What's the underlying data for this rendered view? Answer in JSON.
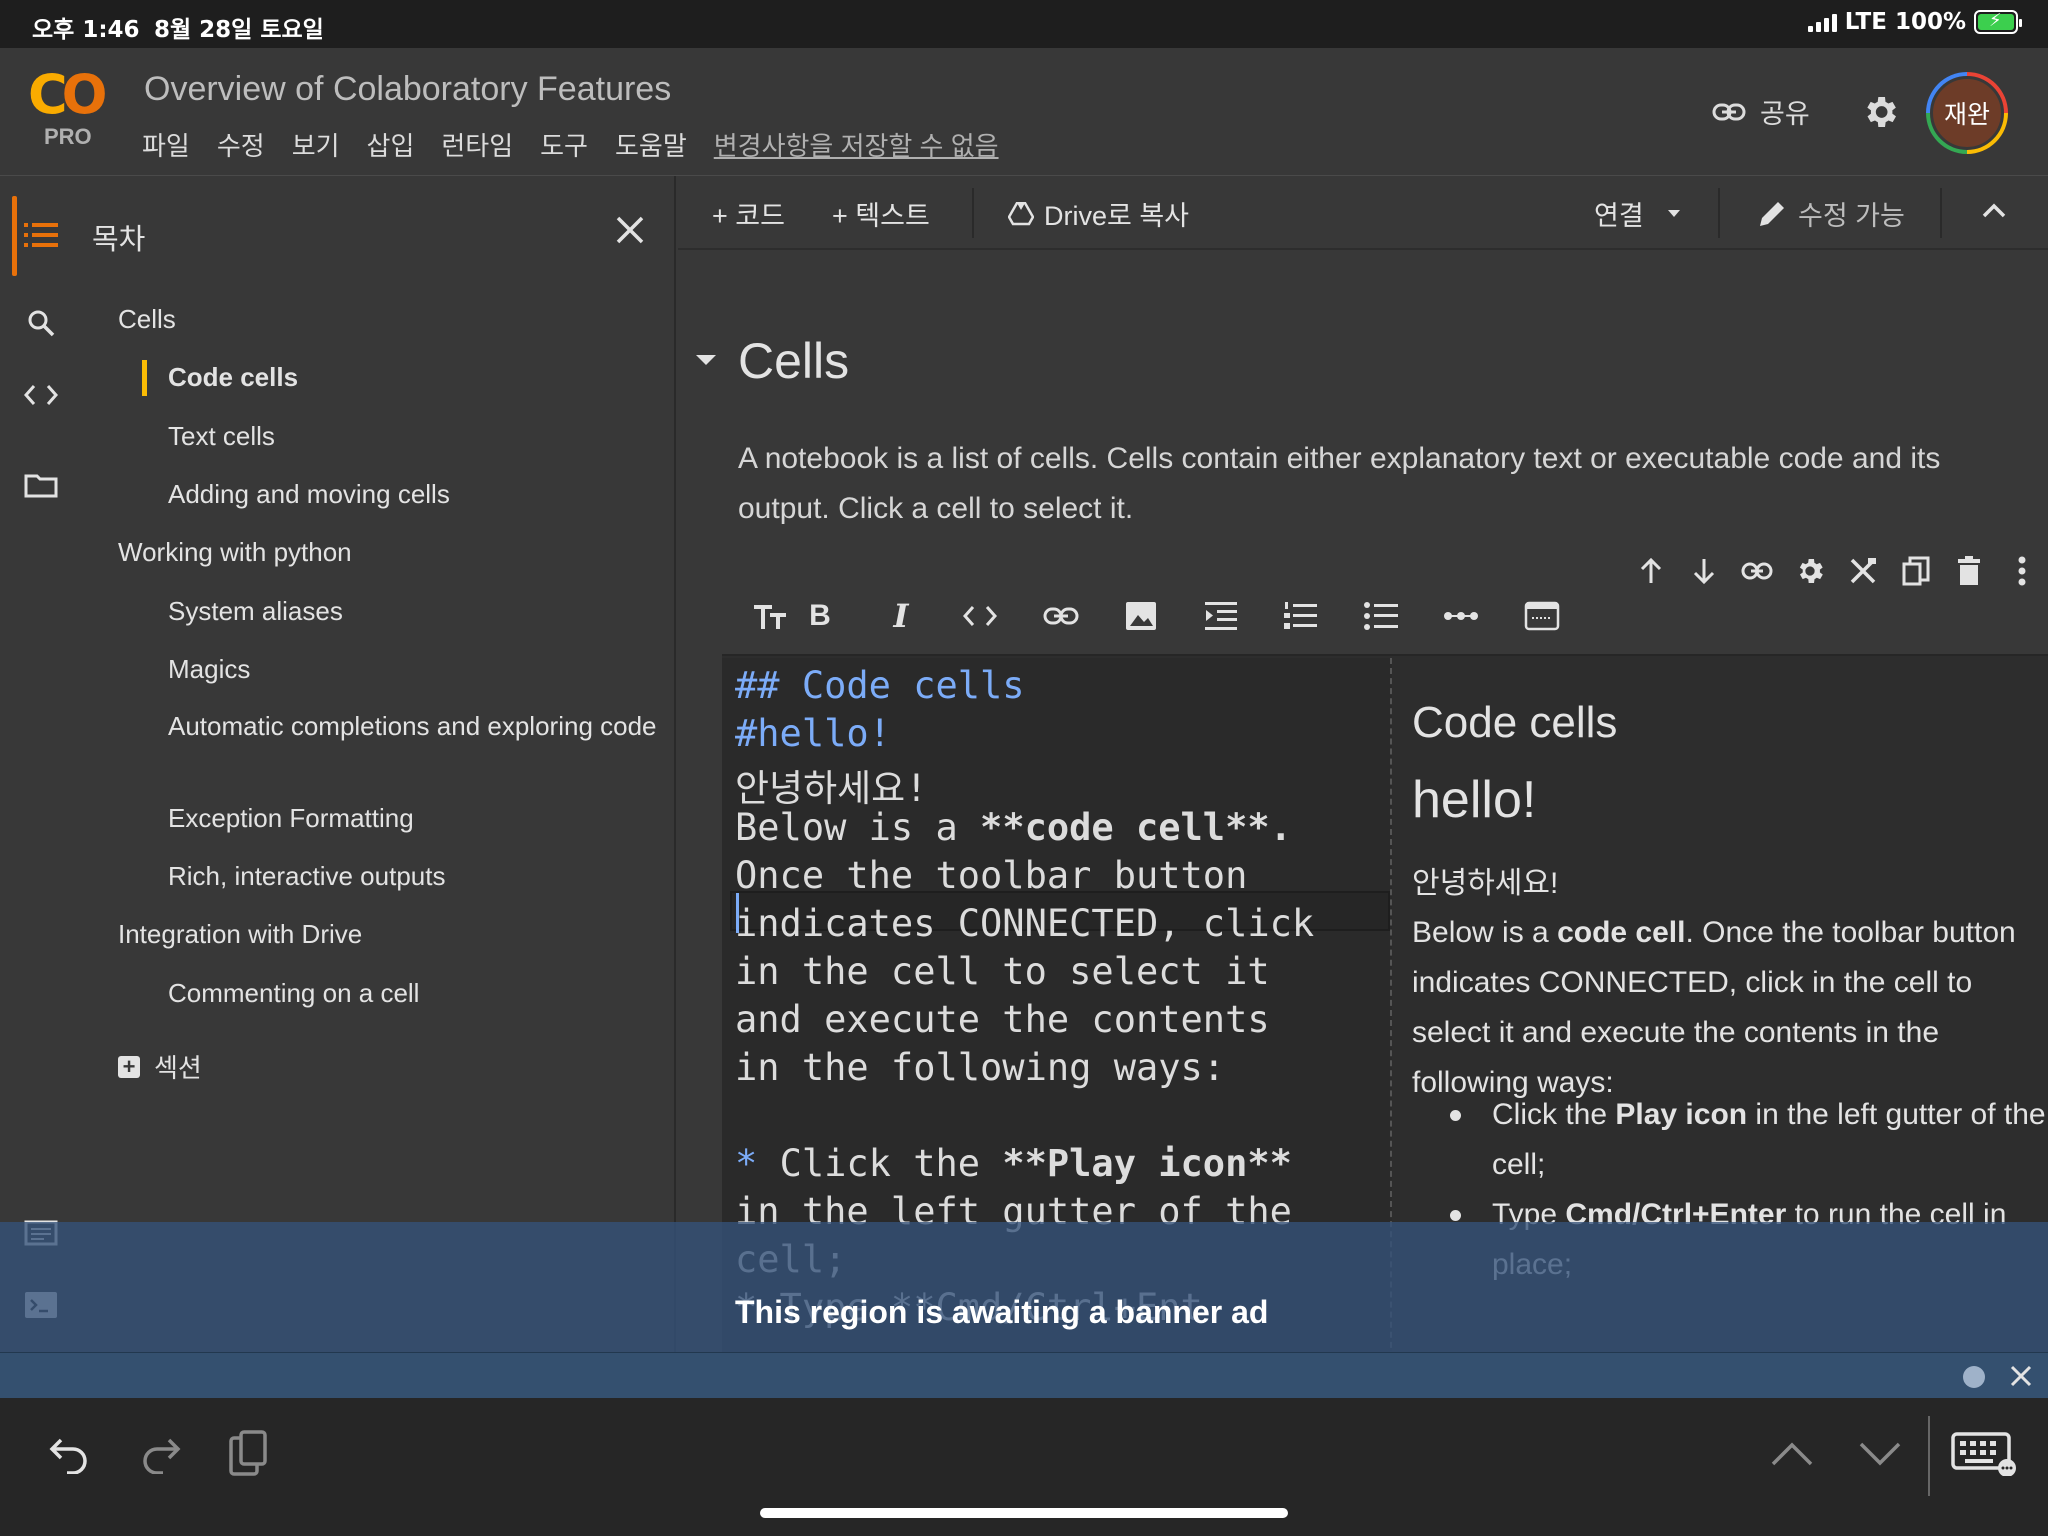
{
  "status_bar": {
    "time": "오후 1:46",
    "date": "8월 28일 토요일",
    "network": "LTE",
    "battery": "100%",
    "battery_color": "#3ccf4e"
  },
  "header": {
    "logo_text": "CO",
    "logo_badge": "PRO",
    "title": "Overview of Colaboratory Features",
    "menu": [
      "파일",
      "수정",
      "보기",
      "삽입",
      "런타임",
      "도구",
      "도움말"
    ],
    "unsaved_notice": "변경사항을 저장할 수 없음",
    "share_label": "공유",
    "avatar_text": "재완",
    "accent_color": "#f9ab00"
  },
  "rail": {
    "icons": [
      "toc-icon",
      "search-icon",
      "code-snippets-icon",
      "folder-icon",
      "command-palette-icon",
      "terminal-icon"
    ]
  },
  "toc": {
    "title": "목차",
    "items": [
      {
        "label": "Cells",
        "level": 1
      },
      {
        "label": "Code cells",
        "level": 2,
        "active": true
      },
      {
        "label": "Text cells",
        "level": 2
      },
      {
        "label": "Adding and moving cells",
        "level": 2
      },
      {
        "label": "Working with python",
        "level": 1
      },
      {
        "label": "System aliases",
        "level": 2
      },
      {
        "label": "Magics",
        "level": 2
      },
      {
        "label": "Automatic completions and exploring code",
        "level": 2
      },
      {
        "label": "Exception Formatting",
        "level": 2
      },
      {
        "label": "Rich, interactive outputs",
        "level": 2
      },
      {
        "label": "Integration with Drive",
        "level": 1
      },
      {
        "label": "Commenting on a cell",
        "level": 2
      }
    ],
    "add_section_label": "섹션"
  },
  "toolbar": {
    "add_code": "+ 코드",
    "add_text": "+ 텍스트",
    "copy_to_drive": "Drive로 복사",
    "connect": "연결",
    "edit_mode": "수정 가능"
  },
  "section": {
    "heading": "Cells",
    "paragraph": "A notebook is a list of cells. Cells contain either explanatory text or executable code and its output. Click a cell to select it."
  },
  "editor": {
    "lines": {
      "l1": "## Code cells",
      "l2": "#hello!",
      "l3": "안녕하세요!",
      "l4a": "Below is a ",
      "l4b": "**code cell**.",
      "l5": "Once the toolbar button",
      "l6": "indicates CONNECTED, click",
      "l7": "in the cell to select it",
      "l8": "and execute the contents",
      "l9": "in the following ways:",
      "l10a": "* ",
      "l10b": "Click the ",
      "l10c": "**Play icon**",
      "l11": "in the left gutter of the",
      "l12": "cell;",
      "l13": "* Type **Cmd/Ctrl+Ent"
    }
  },
  "preview": {
    "h2": "Code cells",
    "h1": "hello!",
    "p1": "안녕하세요!",
    "p2_pre": "Below is a ",
    "p2_bold": "code cell",
    "p2_post": ". Once the toolbar button indicates CONNECTED, click in the cell to select it and execute the contents in the following ways:",
    "bullet1_pre": "Click the ",
    "bullet1_bold": "Play icon",
    "bullet1_post": " in the left gutter of the cell;",
    "bullet2_pre": "Type ",
    "bullet2_bold": "Cmd/Ctrl+Enter",
    "bullet2_post": " to run the cell in place;"
  },
  "ad": {
    "text": "This region is awaiting a banner ad"
  }
}
